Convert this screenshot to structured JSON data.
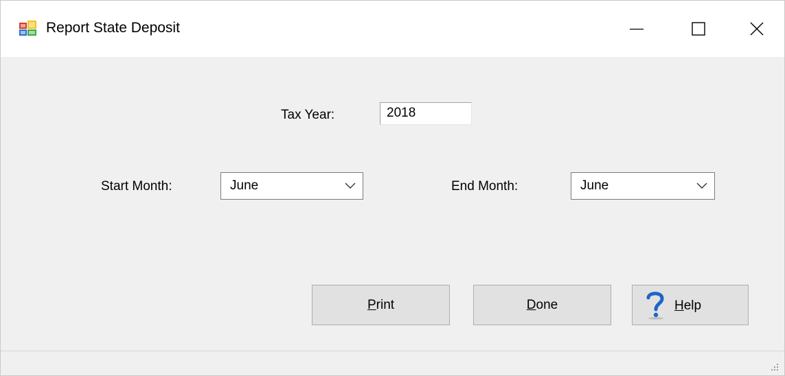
{
  "window": {
    "title": "Report State Deposit",
    "icon": "report-app-icon",
    "controls": [
      "minimize-icon",
      "maximize-icon",
      "close-icon"
    ]
  },
  "form": {
    "tax_year": {
      "label": "Tax Year:",
      "value": "2018"
    },
    "start_month": {
      "label": "Start Month:",
      "selected": "June"
    },
    "end_month": {
      "label": "End Month:",
      "selected": "June"
    }
  },
  "buttons": {
    "print": {
      "mnemonic": "P",
      "rest": "rint"
    },
    "done": {
      "mnemonic": "D",
      "rest": "one"
    },
    "help": {
      "mnemonic": "H",
      "rest": "elp",
      "icon": "question-mark-icon"
    }
  },
  "colors": {
    "client_background": "#f0f0f0",
    "button_face": "#e1e1e1",
    "help_icon": "#1e64c8"
  }
}
